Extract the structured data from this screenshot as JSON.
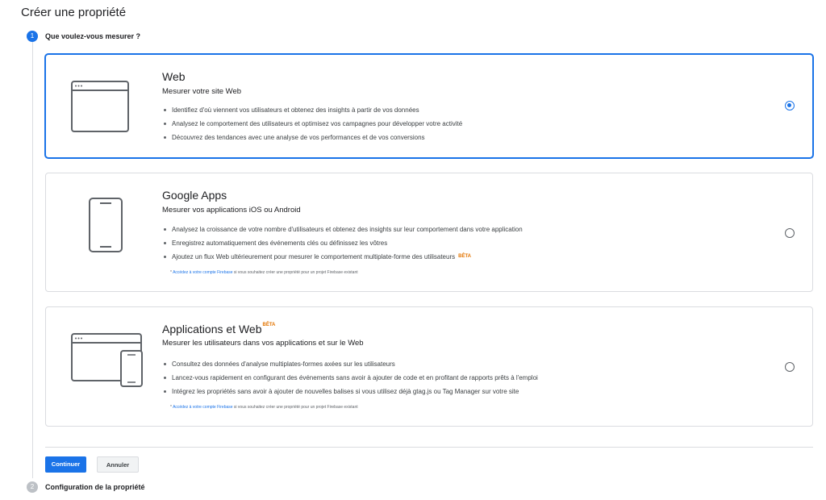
{
  "page": {
    "title": "Créer une propriété"
  },
  "steps": [
    {
      "number": "1",
      "title": "Que voulez-vous mesurer ?",
      "state": "active"
    },
    {
      "number": "2",
      "title": "Configuration de la propriété",
      "state": "inactive"
    }
  ],
  "options": {
    "web": {
      "title": "Web",
      "subtitle": "Mesurer votre site Web",
      "selected": true,
      "icon": "browser-window-icon",
      "bullets": [
        "Identifiez d'où viennent vos utilisateurs et obtenez des insights à partir de vos données",
        "Analysez le comportement des utilisateurs et optimisez vos campagnes pour développer votre activité",
        "Découvrez des tendances avec une analyse de vos performances et de vos conversions"
      ]
    },
    "apps": {
      "title": "Google Apps",
      "subtitle": "Mesurer vos applications iOS ou Android",
      "selected": false,
      "icon": "smartphone-icon",
      "bullets": [
        "Analysez la croissance de votre nombre d'utilisateurs et obtenez des insights sur leur comportement dans votre application",
        "Enregistrez automatiquement des événements clés ou définissez les vôtres",
        "Ajoutez un flux Web ultérieurement pour mesurer le comportement multiplate-forme des utilisateurs"
      ],
      "bullet_badge": "BÊTA",
      "note_prefix": "* ",
      "note_link": "Accédez à votre compte Firebase",
      "note_suffix": " si vous souhaitez créer une propriété pour un projet Firebase existant"
    },
    "appweb": {
      "title": "Applications et Web",
      "title_badge": "BÊTA",
      "subtitle": "Mesurer les utilisateurs dans vos applications et sur le Web",
      "selected": false,
      "icon": "browser-and-phone-icon",
      "bullets": [
        "Consultez des données d'analyse multiplates-formes axées sur les utilisateurs",
        "Lancez-vous rapidement en configurant des événements sans avoir à ajouter de code et en profitant de rapports prêts à l'emploi",
        "Intégrez les propriétés sans avoir à ajouter de nouvelles balises si vous utilisez déjà gtag.js ou Tag Manager sur votre site"
      ],
      "note_prefix": "* ",
      "note_link": "Accédez à votre compte Firebase",
      "note_suffix": " si vous souhaitez créer une propriété pour un projet Firebase existant"
    }
  },
  "actions": {
    "continue_label": "Continuer",
    "cancel_label": "Annuler"
  },
  "colors": {
    "accent": "#1a73e8",
    "beta": "#e37400",
    "border": "#dadce0"
  }
}
